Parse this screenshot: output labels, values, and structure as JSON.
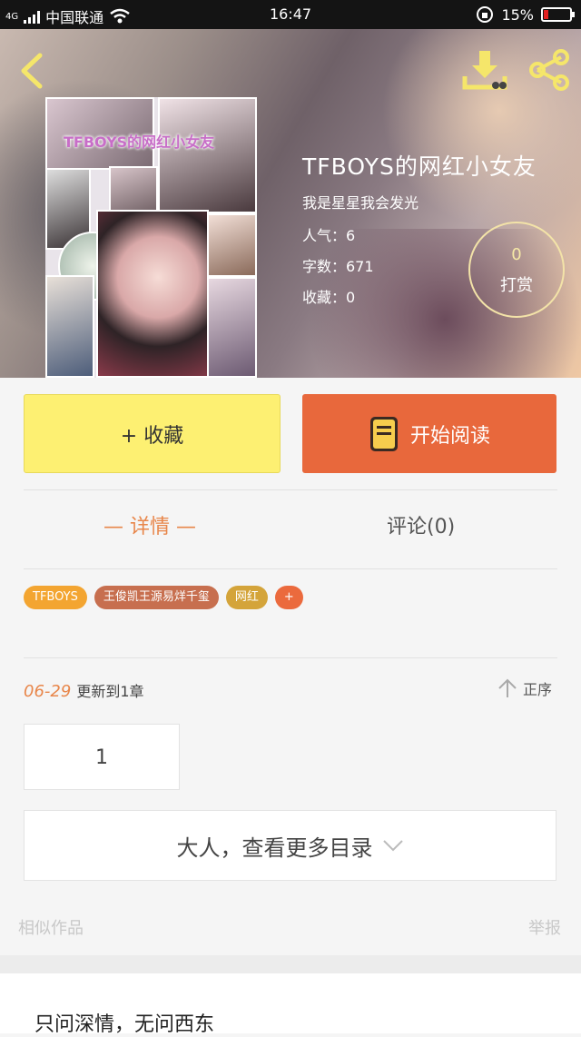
{
  "status": {
    "network": "4G",
    "carrier": "中国联通",
    "time": "16:47",
    "battery_percent": "15%",
    "battery_level": 0.15
  },
  "book": {
    "title": "TFBOYS的网红小女友",
    "cover_title": "TFBOYS的网红小女友",
    "author": "我是星星我会发光",
    "popularity": "人气：6",
    "words": "字数：671",
    "favorites": "收藏：0"
  },
  "reward": {
    "count": "0",
    "label": "打赏"
  },
  "actions": {
    "favorite_label": "+ 收藏",
    "read_label": "开始阅读"
  },
  "tabs": [
    {
      "label": "— 详情 —",
      "active": true
    },
    {
      "label": "评论(0)",
      "active": false
    }
  ],
  "tags": [
    {
      "label": "TFBOYS",
      "color": "#f3a531"
    },
    {
      "label": "王俊凯王源易烊千玺",
      "color": "#c76f4f"
    },
    {
      "label": "网红",
      "color": "#d4a43a"
    },
    {
      "label": "+",
      "color": "#eb6a3d"
    }
  ],
  "update": {
    "date": "06-29",
    "text": "更新到1章",
    "sort_label": "正序"
  },
  "chapters": [
    "1"
  ],
  "more_label": "大人，查看更多目录",
  "footer": {
    "similar": "相似作品",
    "report": "举报"
  },
  "recommendation": {
    "title": "只问深情，无问西东"
  },
  "colors": {
    "accent": "#e8864a",
    "read_button": "#e8683c",
    "fav_button": "#fdf072",
    "icon_yellow": "#f5e66a"
  }
}
